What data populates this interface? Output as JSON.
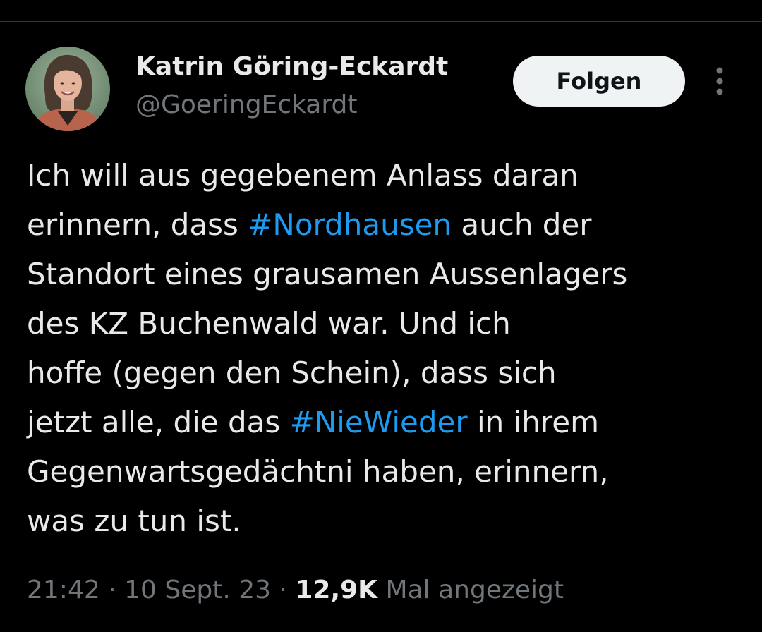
{
  "author": {
    "display_name": "Katrin Göring-Eckardt",
    "handle": "@GoeringEckardt",
    "avatar_icon": "profile-photo"
  },
  "follow_button": {
    "label": "Folgen"
  },
  "more_menu": {
    "icon": "vertical-ellipsis-icon"
  },
  "tweet": {
    "lines": [
      [
        {
          "text": "Ich will aus gegebenem Anlass daran"
        }
      ],
      [
        {
          "text": "erinnern, dass "
        },
        {
          "text": "#Nordhausen",
          "hashtag": true
        },
        {
          "text": " auch der"
        }
      ],
      [
        {
          "text": "Standort eines grausamen Aussenlagers"
        }
      ],
      [
        {
          "text": "des KZ Buchenwald war. Und ich"
        }
      ],
      [
        {
          "text": "hoffe (gegen den Schein), dass sich"
        }
      ],
      [
        {
          "text": "jetzt alle, die das "
        },
        {
          "text": "#NieWieder",
          "hashtag": true
        },
        {
          "text": " in ihrem"
        }
      ],
      [
        {
          "text": "Gegenwartsgedächtni haben, erinnern,"
        }
      ],
      [
        {
          "text": "was zu tun ist."
        }
      ]
    ]
  },
  "meta": {
    "time": "21:42",
    "separator": " · ",
    "date": "10 Sept. 23",
    "views_count": "12,9K",
    "views_label": " Mal angezeigt"
  },
  "colors": {
    "background": "#000000",
    "text": "#e7e9ea",
    "secondary": "#71767b",
    "hashtag": "#1d9bf0",
    "button_bg": "#eff3f4"
  }
}
